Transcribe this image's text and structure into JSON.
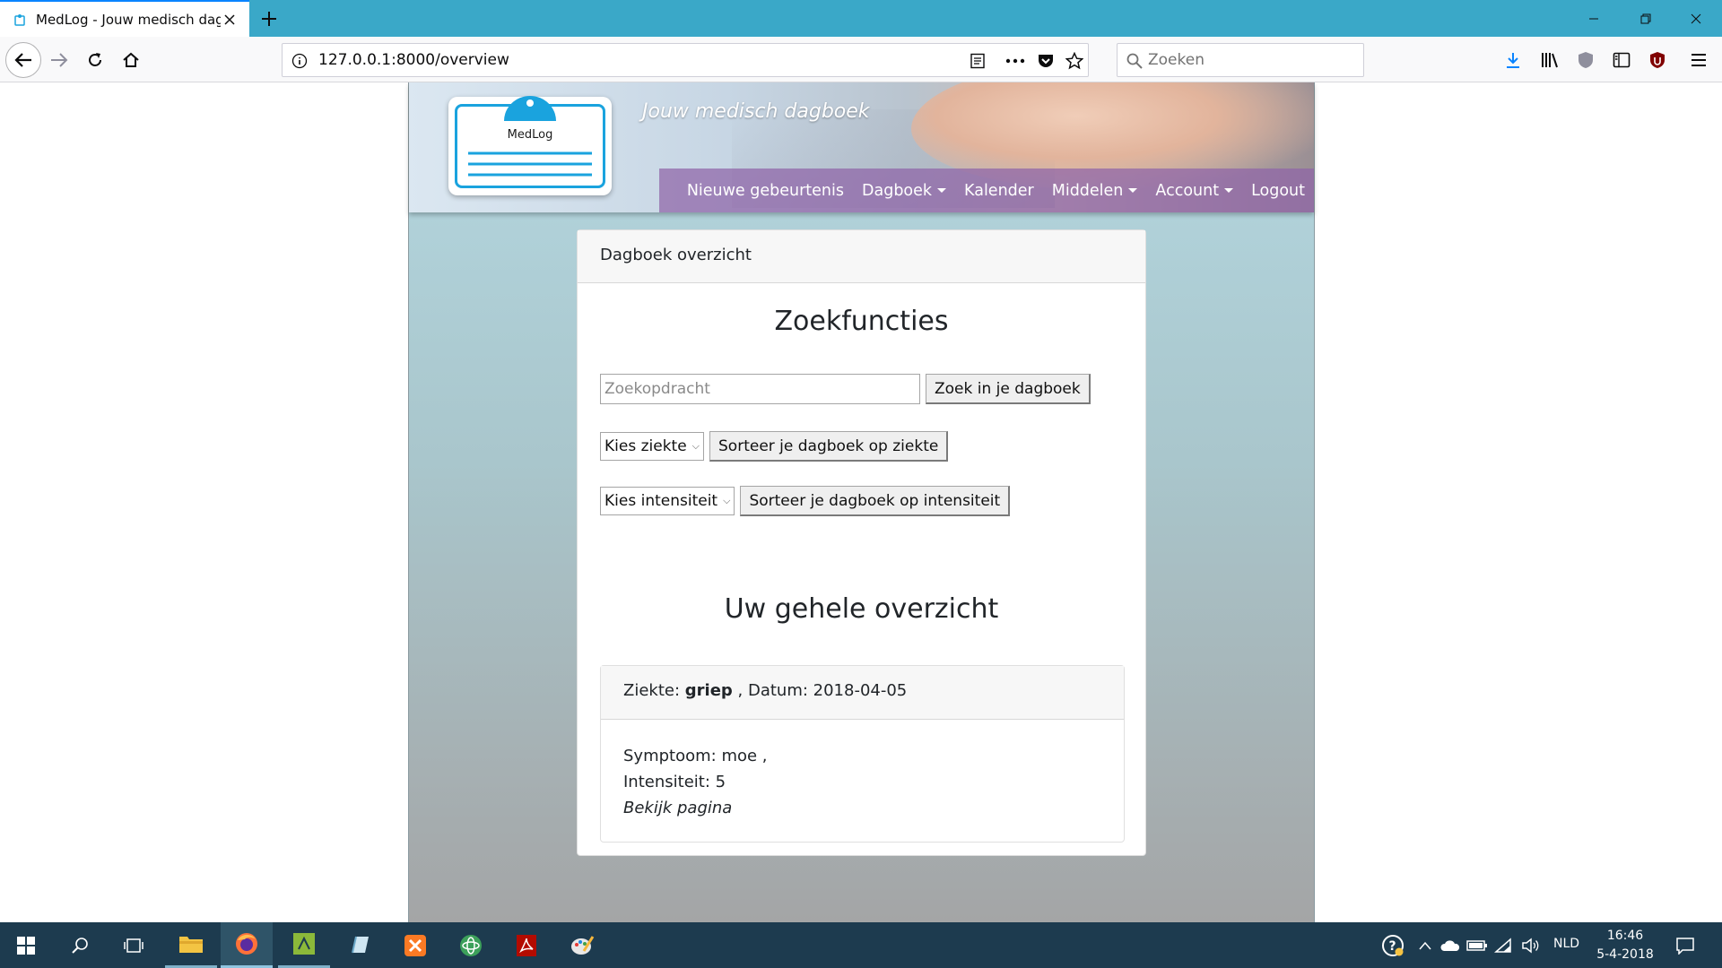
{
  "browser": {
    "tab_title": "MedLog - Jouw medisch dagboek",
    "url": "127.0.0.1:8000/overview",
    "search_placeholder": "Zoeken"
  },
  "site": {
    "logo_text": "MedLog",
    "tagline": "Jouw medisch dagboek",
    "menu": [
      {
        "label": "Nieuwe gebeurtenis",
        "dropdown": false
      },
      {
        "label": "Dagboek",
        "dropdown": true
      },
      {
        "label": "Kalender",
        "dropdown": false
      },
      {
        "label": "Middelen",
        "dropdown": true
      },
      {
        "label": "Account",
        "dropdown": true
      },
      {
        "label": "Logout",
        "dropdown": false
      }
    ]
  },
  "card": {
    "header": "Dagboek overzicht",
    "search_title": "Zoekfuncties",
    "search_placeholder": "Zoekopdracht",
    "search_button": "Zoek in je dagboek",
    "ziekte_select": "Kies ziekte",
    "ziekte_button": "Sorteer je dagboek op ziekte",
    "intensiteit_select": "Kies intensiteit",
    "intensiteit_button": "Sorteer je dagboek op intensiteit",
    "overview_title": "Uw gehele overzicht",
    "entry": {
      "ziekte_label": "Ziekte:",
      "ziekte_value": "griep",
      "datum_text": ", Datum: 2018-04-05",
      "symptoom": "Symptoom: moe ,",
      "intensiteit": "Intensiteit: 5",
      "link": "Bekijk pagina"
    }
  },
  "taskbar": {
    "language": "NLD",
    "time": "16:46",
    "date": "5-4-2018"
  },
  "colors": {
    "titlebar": "#3aa8c8",
    "menu_bg": "#8f64a8",
    "logo_accent": "#1aa3de",
    "taskbar": "#1d3b4f"
  }
}
